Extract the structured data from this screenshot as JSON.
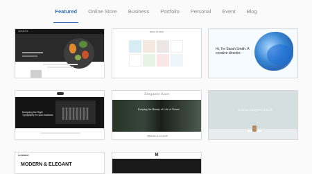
{
  "tabs": [
    {
      "label": "Featured",
      "active": true
    },
    {
      "label": "Online Store",
      "active": false
    },
    {
      "label": "Business",
      "active": false
    },
    {
      "label": "Portfolio",
      "active": false
    },
    {
      "label": "Personal",
      "active": false
    },
    {
      "label": "Event",
      "active": false
    },
    {
      "label": "Blog",
      "active": false
    }
  ],
  "cards": {
    "c1": {
      "brand": "CREATIVE"
    },
    "c2": {
      "header": "MIRAI STUDIO"
    },
    "c3": {
      "hero_text": "Hi, I'm Sarah Smith. A creative director."
    },
    "c4": {
      "hero_text": "Designing the Right Typography for your business"
    },
    "c5": {
      "brand": "Elegante Kate",
      "hero_text": "Keeping the Beauty of Life of Nature",
      "footer_text": "Welcome to our world"
    },
    "c6": {
      "hero_text": "Spaces Designed & Built"
    },
    "c7": {
      "label": "LAVENDAY",
      "title": "MODERN & ELEGANT"
    },
    "c8": {
      "logo": "M"
    }
  }
}
